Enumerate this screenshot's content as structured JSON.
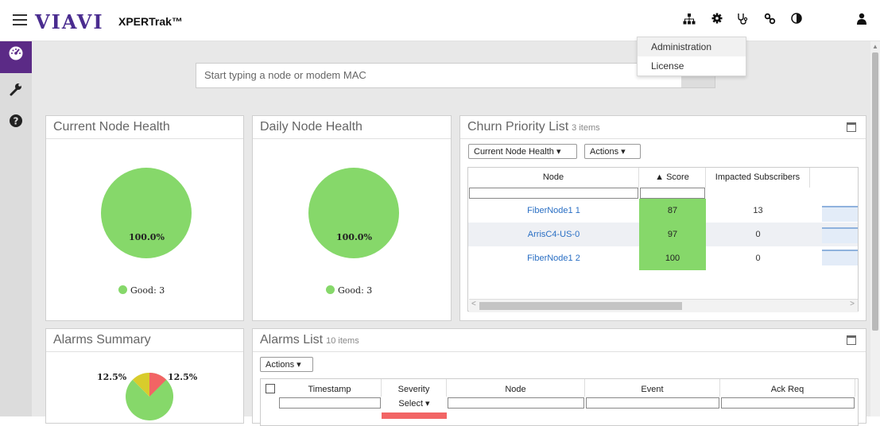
{
  "app": {
    "brand": "VIAVI",
    "product": "XPERTrak™"
  },
  "header_icons": [
    "network-icon",
    "gear-icon",
    "stethoscope-icon",
    "link-icon",
    "contrast-icon",
    "user-icon"
  ],
  "user_menu": {
    "items": [
      "Administration",
      "License"
    ]
  },
  "sidebar": {
    "items": [
      "dashboard-icon",
      "wrench-icon",
      "help-icon"
    ]
  },
  "search": {
    "placeholder": "Start typing a node or modem MAC"
  },
  "current_node_health": {
    "title": "Current Node Health",
    "pie_label": "100.0%",
    "legend": "Good: 3",
    "color": "#86d86a"
  },
  "daily_node_health": {
    "title": "Daily Node Health",
    "pie_label": "100.0%",
    "legend": "Good: 3",
    "color": "#86d86a"
  },
  "churn": {
    "title": "Churn Priority List",
    "count": "3 items",
    "filter_label": "Current Node Health",
    "actions_label": "Actions",
    "columns": [
      "Node",
      "▲ Score",
      "Impacted Subscribers"
    ],
    "rows": [
      {
        "node": "FiberNode1 1",
        "score": "87",
        "subs": "13"
      },
      {
        "node": "ArrisC4-US-0",
        "score": "97",
        "subs": "0"
      },
      {
        "node": "FiberNode1 2",
        "score": "100",
        "subs": "0"
      }
    ]
  },
  "alarms_summary": {
    "title": "Alarms Summary",
    "left_label": "12.5%",
    "right_label": "12.5%"
  },
  "alarms_list": {
    "title": "Alarms List",
    "count": "10 items",
    "actions_label": "Actions",
    "columns": [
      "Timestamp",
      "Severity",
      "Node",
      "Event",
      "Ack Req"
    ],
    "severity_filter": "Select"
  },
  "colors": {
    "brand_purple": "#5b2a86",
    "good_green": "#86d86a",
    "critical_red": "#f26464",
    "warning_yellow": "#d8cc2c",
    "link_blue": "#2a6fc4"
  }
}
